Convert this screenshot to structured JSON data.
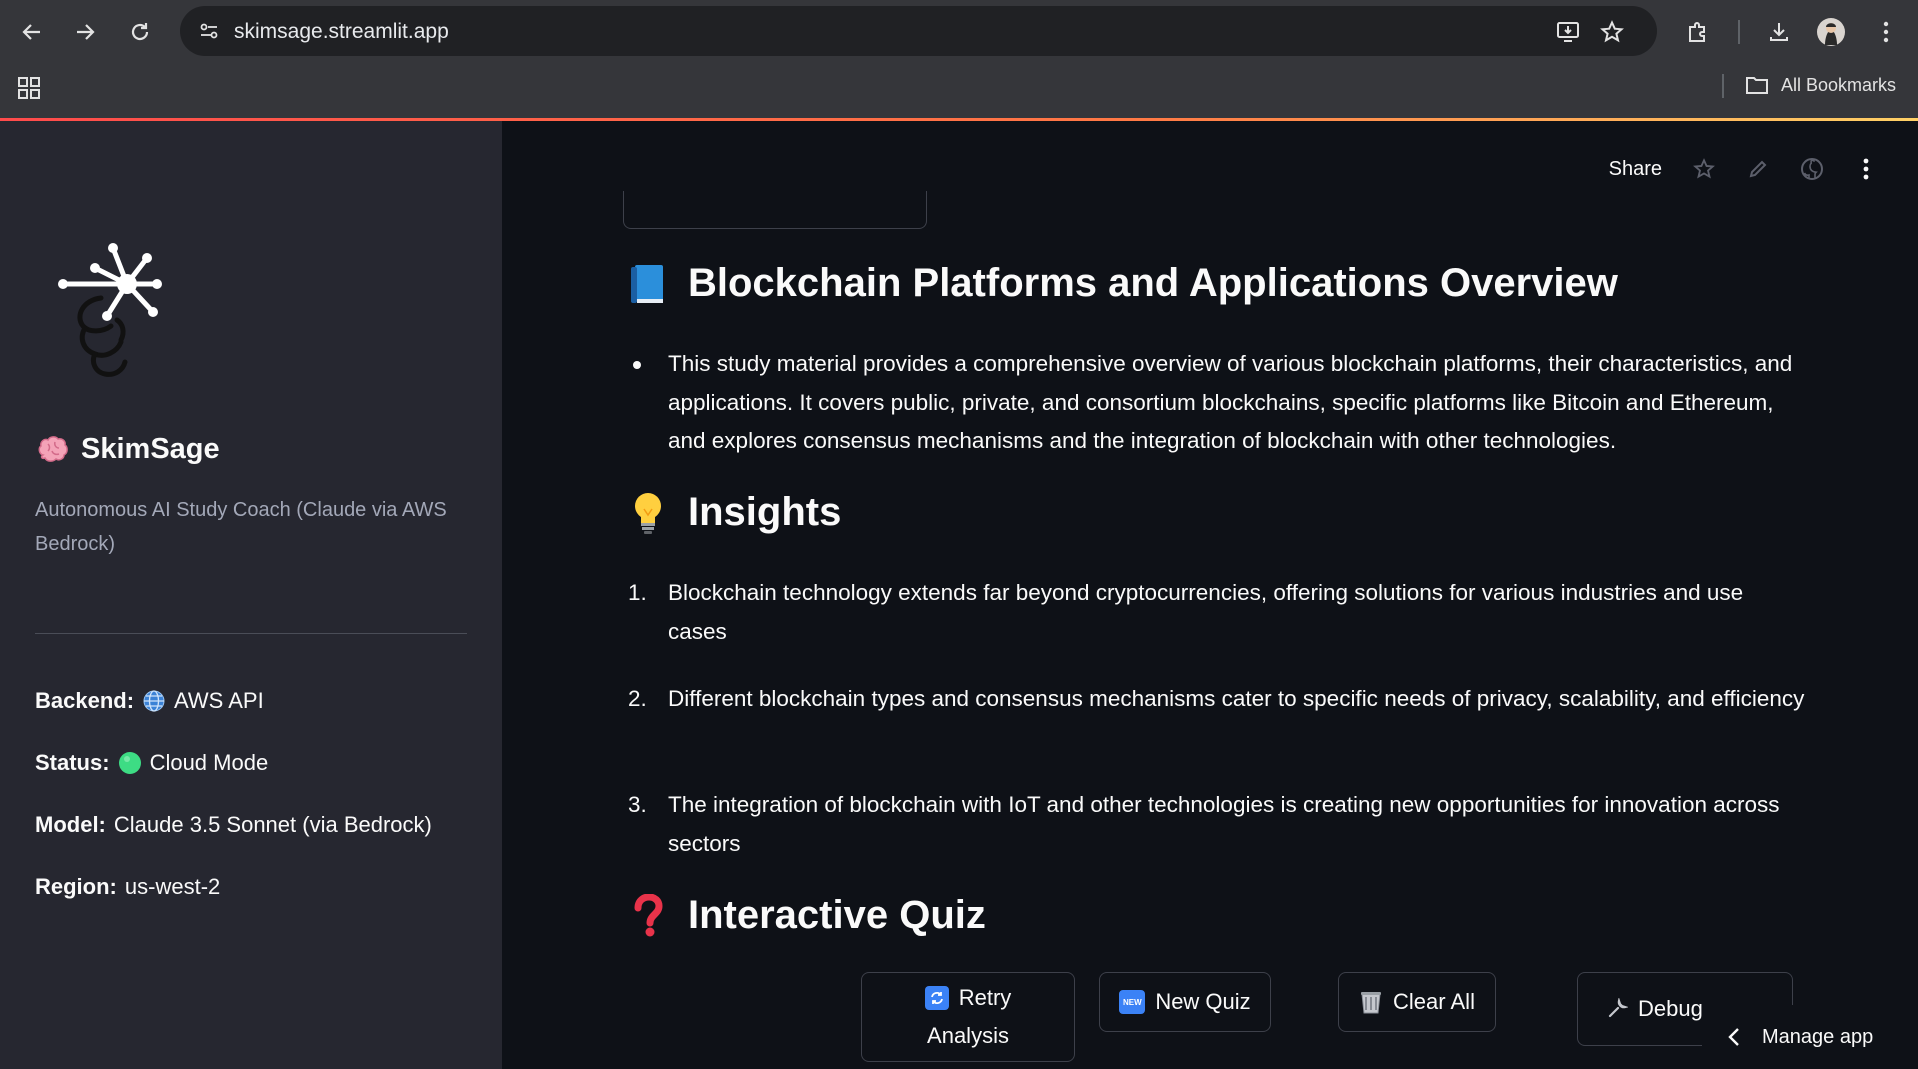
{
  "browser": {
    "url": "skimsage.streamlit.app",
    "all_bookmarks": "All Bookmarks"
  },
  "sidebar": {
    "app_name": "SkimSage",
    "subtitle": "Autonomous AI Study Coach (Claude via AWS Bedrock)",
    "info": [
      {
        "key": "Backend:",
        "value": "AWS API",
        "icon": "globe-icon"
      },
      {
        "key": "Status:",
        "value": "Cloud Mode",
        "icon": "green-circle-icon"
      },
      {
        "key": "Model:",
        "value": "Claude 3.5 Sonnet (via Bedrock)"
      },
      {
        "key": "Region:",
        "value": "us-west-2"
      }
    ]
  },
  "toolbar": {
    "share_label": "Share"
  },
  "main": {
    "overview_title": "Blockchain Platforms and Applications Overview",
    "overview_text": "This study material provides a comprehensive overview of various blockchain platforms, their characteristics, and applications. It covers public, private, and consortium blockchains, specific platforms like Bitcoin and Ethereum, and explores consensus mechanisms and the integration of blockchain with other technologies.",
    "insights_title": "Insights",
    "insights": [
      {
        "num": "1.",
        "text": "Blockchain technology extends far beyond cryptocurrencies, offering solutions for various industries and use cases"
      },
      {
        "num": "2.",
        "text": "Different blockchain types and consensus mechanisms cater to specific needs of privacy, scalability, and efficiency"
      },
      {
        "num": "3.",
        "text": "The integration of blockchain with IoT and other technologies is creating new opportunities for innovation across sectors"
      }
    ],
    "quiz_title": "Interactive Quiz",
    "buttons": {
      "retry": "Retry Analysis",
      "retry_line1": "Retry",
      "retry_line2": "Analysis",
      "new_quiz": "New Quiz",
      "new_badge": "NEW",
      "clear_all": "Clear All",
      "debug": "Debug"
    }
  },
  "manage_app": "Manage app",
  "colors": {
    "accent": "#ff4b4b",
    "status_green": "#3ddc84",
    "sidebar_bg": "#262730",
    "main_bg": "#0e1117"
  }
}
